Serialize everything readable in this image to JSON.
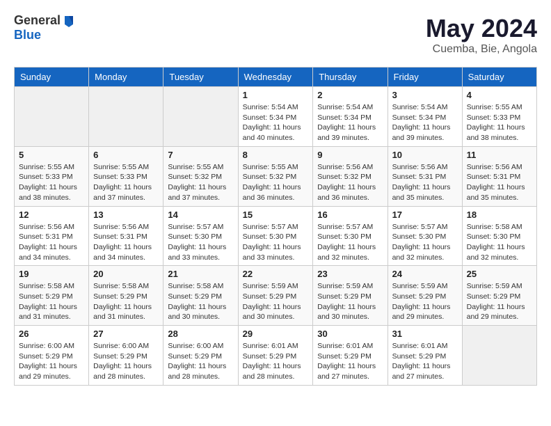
{
  "header": {
    "logo_general": "General",
    "logo_blue": "Blue",
    "month": "May 2024",
    "location": "Cuemba, Bie, Angola"
  },
  "days_of_week": [
    "Sunday",
    "Monday",
    "Tuesday",
    "Wednesday",
    "Thursday",
    "Friday",
    "Saturday"
  ],
  "weeks": [
    [
      {
        "day": "",
        "info": ""
      },
      {
        "day": "",
        "info": ""
      },
      {
        "day": "",
        "info": ""
      },
      {
        "day": "1",
        "info": "Sunrise: 5:54 AM\nSunset: 5:34 PM\nDaylight: 11 hours\nand 40 minutes."
      },
      {
        "day": "2",
        "info": "Sunrise: 5:54 AM\nSunset: 5:34 PM\nDaylight: 11 hours\nand 39 minutes."
      },
      {
        "day": "3",
        "info": "Sunrise: 5:54 AM\nSunset: 5:34 PM\nDaylight: 11 hours\nand 39 minutes."
      },
      {
        "day": "4",
        "info": "Sunrise: 5:55 AM\nSunset: 5:33 PM\nDaylight: 11 hours\nand 38 minutes."
      }
    ],
    [
      {
        "day": "5",
        "info": "Sunrise: 5:55 AM\nSunset: 5:33 PM\nDaylight: 11 hours\nand 38 minutes."
      },
      {
        "day": "6",
        "info": "Sunrise: 5:55 AM\nSunset: 5:33 PM\nDaylight: 11 hours\nand 37 minutes."
      },
      {
        "day": "7",
        "info": "Sunrise: 5:55 AM\nSunset: 5:32 PM\nDaylight: 11 hours\nand 37 minutes."
      },
      {
        "day": "8",
        "info": "Sunrise: 5:55 AM\nSunset: 5:32 PM\nDaylight: 11 hours\nand 36 minutes."
      },
      {
        "day": "9",
        "info": "Sunrise: 5:56 AM\nSunset: 5:32 PM\nDaylight: 11 hours\nand 36 minutes."
      },
      {
        "day": "10",
        "info": "Sunrise: 5:56 AM\nSunset: 5:31 PM\nDaylight: 11 hours\nand 35 minutes."
      },
      {
        "day": "11",
        "info": "Sunrise: 5:56 AM\nSunset: 5:31 PM\nDaylight: 11 hours\nand 35 minutes."
      }
    ],
    [
      {
        "day": "12",
        "info": "Sunrise: 5:56 AM\nSunset: 5:31 PM\nDaylight: 11 hours\nand 34 minutes."
      },
      {
        "day": "13",
        "info": "Sunrise: 5:56 AM\nSunset: 5:31 PM\nDaylight: 11 hours\nand 34 minutes."
      },
      {
        "day": "14",
        "info": "Sunrise: 5:57 AM\nSunset: 5:30 PM\nDaylight: 11 hours\nand 33 minutes."
      },
      {
        "day": "15",
        "info": "Sunrise: 5:57 AM\nSunset: 5:30 PM\nDaylight: 11 hours\nand 33 minutes."
      },
      {
        "day": "16",
        "info": "Sunrise: 5:57 AM\nSunset: 5:30 PM\nDaylight: 11 hours\nand 32 minutes."
      },
      {
        "day": "17",
        "info": "Sunrise: 5:57 AM\nSunset: 5:30 PM\nDaylight: 11 hours\nand 32 minutes."
      },
      {
        "day": "18",
        "info": "Sunrise: 5:58 AM\nSunset: 5:30 PM\nDaylight: 11 hours\nand 32 minutes."
      }
    ],
    [
      {
        "day": "19",
        "info": "Sunrise: 5:58 AM\nSunset: 5:29 PM\nDaylight: 11 hours\nand 31 minutes."
      },
      {
        "day": "20",
        "info": "Sunrise: 5:58 AM\nSunset: 5:29 PM\nDaylight: 11 hours\nand 31 minutes."
      },
      {
        "day": "21",
        "info": "Sunrise: 5:58 AM\nSunset: 5:29 PM\nDaylight: 11 hours\nand 30 minutes."
      },
      {
        "day": "22",
        "info": "Sunrise: 5:59 AM\nSunset: 5:29 PM\nDaylight: 11 hours\nand 30 minutes."
      },
      {
        "day": "23",
        "info": "Sunrise: 5:59 AM\nSunset: 5:29 PM\nDaylight: 11 hours\nand 30 minutes."
      },
      {
        "day": "24",
        "info": "Sunrise: 5:59 AM\nSunset: 5:29 PM\nDaylight: 11 hours\nand 29 minutes."
      },
      {
        "day": "25",
        "info": "Sunrise: 5:59 AM\nSunset: 5:29 PM\nDaylight: 11 hours\nand 29 minutes."
      }
    ],
    [
      {
        "day": "26",
        "info": "Sunrise: 6:00 AM\nSunset: 5:29 PM\nDaylight: 11 hours\nand 29 minutes."
      },
      {
        "day": "27",
        "info": "Sunrise: 6:00 AM\nSunset: 5:29 PM\nDaylight: 11 hours\nand 28 minutes."
      },
      {
        "day": "28",
        "info": "Sunrise: 6:00 AM\nSunset: 5:29 PM\nDaylight: 11 hours\nand 28 minutes."
      },
      {
        "day": "29",
        "info": "Sunrise: 6:01 AM\nSunset: 5:29 PM\nDaylight: 11 hours\nand 28 minutes."
      },
      {
        "day": "30",
        "info": "Sunrise: 6:01 AM\nSunset: 5:29 PM\nDaylight: 11 hours\nand 27 minutes."
      },
      {
        "day": "31",
        "info": "Sunrise: 6:01 AM\nSunset: 5:29 PM\nDaylight: 11 hours\nand 27 minutes."
      },
      {
        "day": "",
        "info": ""
      }
    ]
  ]
}
